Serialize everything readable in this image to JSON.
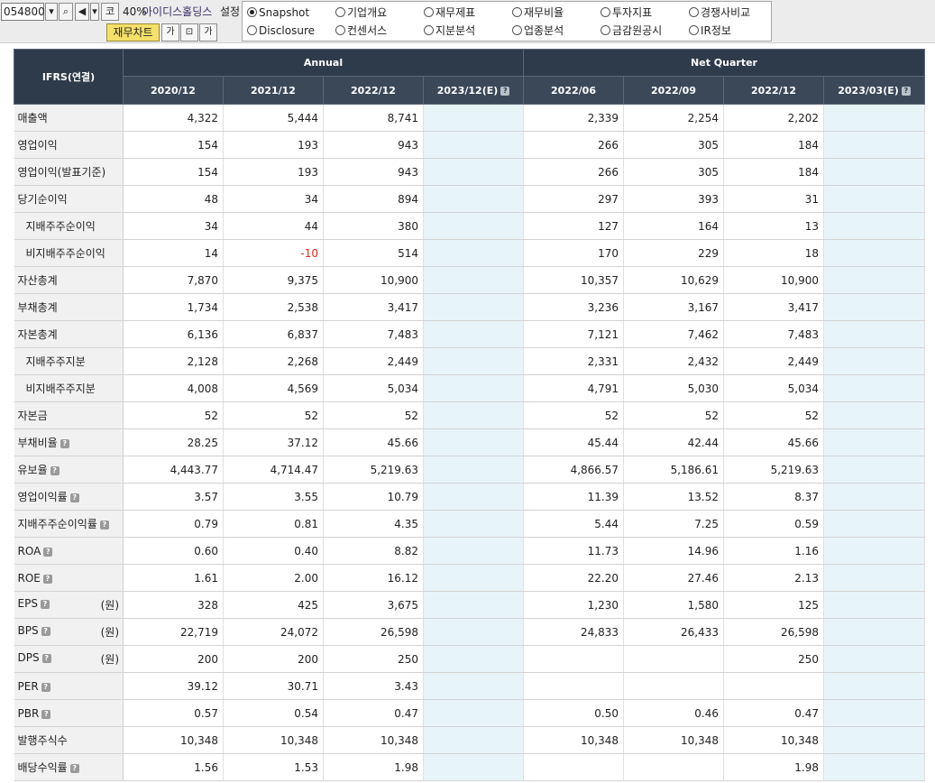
{
  "toolbar": {
    "code": "054800",
    "dropdown_icon": "chevron-down-icon",
    "search_icon": "search-icon",
    "sound_icon": "speaker-icon",
    "code_label": "코",
    "zoom": "40%",
    "company_name": "아이디스홀딩스",
    "setting_label": "설정",
    "fin_chart_label": "재무차트",
    "small_btn_1": "가",
    "small_btn_2": "⊡",
    "small_btn_3": "가"
  },
  "tabs": [
    {
      "label": "Snapshot",
      "selected": true
    },
    {
      "label": "기업개요",
      "selected": false
    },
    {
      "label": "재무제표",
      "selected": false
    },
    {
      "label": "재무비율",
      "selected": false
    },
    {
      "label": "투자지표",
      "selected": false
    },
    {
      "label": "경쟁사비교",
      "selected": false
    },
    {
      "label": "Disclosure",
      "selected": false
    },
    {
      "label": "컨센서스",
      "selected": false
    },
    {
      "label": "지분분석",
      "selected": false
    },
    {
      "label": "업종분석",
      "selected": false
    },
    {
      "label": "금감원공시",
      "selected": false
    },
    {
      "label": "IR정보",
      "selected": false
    }
  ],
  "table": {
    "corner_label": "IFRS(연결)",
    "annual_label": "Annual",
    "quarter_label": "Net Quarter",
    "columns": [
      "2020/12",
      "2021/12",
      "2022/12",
      "2023/12(E)",
      "2022/06",
      "2022/09",
      "2022/12",
      "2023/03(E)"
    ],
    "est_cols": [
      3,
      7
    ],
    "rows": [
      {
        "label": "매출액",
        "indent": false,
        "q": false,
        "unit": "",
        "values": [
          "4,322",
          "5,444",
          "8,741",
          "",
          "2,339",
          "2,254",
          "2,202",
          ""
        ]
      },
      {
        "label": "영업이익",
        "indent": false,
        "q": false,
        "unit": "",
        "values": [
          "154",
          "193",
          "943",
          "",
          "266",
          "305",
          "184",
          ""
        ]
      },
      {
        "label": "영업이익(발표기준)",
        "indent": false,
        "q": false,
        "unit": "",
        "values": [
          "154",
          "193",
          "943",
          "",
          "266",
          "305",
          "184",
          ""
        ]
      },
      {
        "label": "당기순이익",
        "indent": false,
        "q": false,
        "unit": "",
        "values": [
          "48",
          "34",
          "894",
          "",
          "297",
          "393",
          "31",
          ""
        ]
      },
      {
        "label": "지배주주순이익",
        "indent": true,
        "q": false,
        "unit": "",
        "values": [
          "34",
          "44",
          "380",
          "",
          "127",
          "164",
          "13",
          ""
        ]
      },
      {
        "label": "비지배주주순이익",
        "indent": true,
        "q": false,
        "unit": "",
        "values": [
          "14",
          "-10",
          "514",
          "",
          "170",
          "229",
          "18",
          ""
        ]
      },
      {
        "label": "자산총계",
        "indent": false,
        "q": false,
        "unit": "",
        "values": [
          "7,870",
          "9,375",
          "10,900",
          "",
          "10,357",
          "10,629",
          "10,900",
          ""
        ]
      },
      {
        "label": "부채총계",
        "indent": false,
        "q": false,
        "unit": "",
        "values": [
          "1,734",
          "2,538",
          "3,417",
          "",
          "3,236",
          "3,167",
          "3,417",
          ""
        ]
      },
      {
        "label": "자본총계",
        "indent": false,
        "q": false,
        "unit": "",
        "values": [
          "6,136",
          "6,837",
          "7,483",
          "",
          "7,121",
          "7,462",
          "7,483",
          ""
        ]
      },
      {
        "label": "지배주주지분",
        "indent": true,
        "q": false,
        "unit": "",
        "values": [
          "2,128",
          "2,268",
          "2,449",
          "",
          "2,331",
          "2,432",
          "2,449",
          ""
        ]
      },
      {
        "label": "비지배주주지분",
        "indent": true,
        "q": false,
        "unit": "",
        "values": [
          "4,008",
          "4,569",
          "5,034",
          "",
          "4,791",
          "5,030",
          "5,034",
          ""
        ]
      },
      {
        "label": "자본금",
        "indent": false,
        "q": false,
        "unit": "",
        "values": [
          "52",
          "52",
          "52",
          "",
          "52",
          "52",
          "52",
          ""
        ]
      },
      {
        "label": "부채비율",
        "indent": false,
        "q": true,
        "unit": "",
        "values": [
          "28.25",
          "37.12",
          "45.66",
          "",
          "45.44",
          "42.44",
          "45.66",
          ""
        ]
      },
      {
        "label": "유보율",
        "indent": false,
        "q": true,
        "unit": "",
        "values": [
          "4,443.77",
          "4,714.47",
          "5,219.63",
          "",
          "4,866.57",
          "5,186.61",
          "5,219.63",
          ""
        ]
      },
      {
        "label": "영업이익률",
        "indent": false,
        "q": true,
        "unit": "",
        "values": [
          "3.57",
          "3.55",
          "10.79",
          "",
          "11.39",
          "13.52",
          "8.37",
          ""
        ]
      },
      {
        "label": "지배주주순이익률",
        "indent": false,
        "q": true,
        "unit": "",
        "values": [
          "0.79",
          "0.81",
          "4.35",
          "",
          "5.44",
          "7.25",
          "0.59",
          ""
        ]
      },
      {
        "label": "ROA",
        "indent": false,
        "q": true,
        "unit": "",
        "values": [
          "0.60",
          "0.40",
          "8.82",
          "",
          "11.73",
          "14.96",
          "1.16",
          ""
        ]
      },
      {
        "label": "ROE",
        "indent": false,
        "q": true,
        "unit": "",
        "values": [
          "1.61",
          "2.00",
          "16.12",
          "",
          "22.20",
          "27.46",
          "2.13",
          ""
        ]
      },
      {
        "label": "EPS",
        "indent": false,
        "q": true,
        "unit": "(원)",
        "values": [
          "328",
          "425",
          "3,675",
          "",
          "1,230",
          "1,580",
          "125",
          ""
        ]
      },
      {
        "label": "BPS",
        "indent": false,
        "q": true,
        "unit": "(원)",
        "values": [
          "22,719",
          "24,072",
          "26,598",
          "",
          "24,833",
          "26,433",
          "26,598",
          ""
        ]
      },
      {
        "label": "DPS",
        "indent": false,
        "q": true,
        "unit": "(원)",
        "values": [
          "200",
          "200",
          "250",
          "",
          "",
          "",
          "250",
          ""
        ]
      },
      {
        "label": "PER",
        "indent": false,
        "q": true,
        "unit": "",
        "values": [
          "39.12",
          "30.71",
          "3.43",
          "",
          "",
          "",
          "",
          ""
        ]
      },
      {
        "label": "PBR",
        "indent": false,
        "q": true,
        "unit": "",
        "values": [
          "0.57",
          "0.54",
          "0.47",
          "",
          "0.50",
          "0.46",
          "0.47",
          ""
        ]
      },
      {
        "label": "발행주식수",
        "indent": false,
        "q": false,
        "unit": "",
        "values": [
          "10,348",
          "10,348",
          "10,348",
          "",
          "10,348",
          "10,348",
          "10,348",
          ""
        ]
      },
      {
        "label": "배당수익률",
        "indent": false,
        "q": true,
        "unit": "",
        "values": [
          "1.56",
          "1.53",
          "1.98",
          "",
          "",
          "",
          "1.98",
          ""
        ]
      }
    ]
  },
  "colors": {
    "header_bg": "#2e3b4a",
    "estimate_bg": "#e8f5f8",
    "label_bg": "#f1f1f1",
    "negative": "#e0261b",
    "chart_button": "#f5e06a"
  }
}
